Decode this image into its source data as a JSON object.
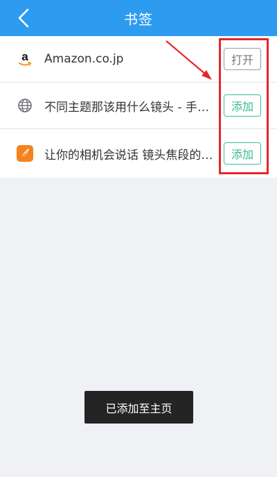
{
  "header": {
    "title": "书签",
    "back_icon": "chevron-left-icon",
    "background_color": "#2d9cf0"
  },
  "bookmarks": [
    {
      "icon": "amazon-logo-icon",
      "title": "Amazon.co.jp",
      "button_label": "打开"
    },
    {
      "icon": "globe-icon",
      "title": "不同主题那该用什么镜头 - 手…",
      "button_label": "添加"
    },
    {
      "icon": "feather-app-icon",
      "title": "让你的相机会说话 镜头焦段的…",
      "button_label": "添加"
    }
  ],
  "colors": {
    "add_button": "#35b894",
    "open_button": "#777777",
    "annotation": "#e52629"
  },
  "toast": {
    "message": "已添加至主页"
  }
}
